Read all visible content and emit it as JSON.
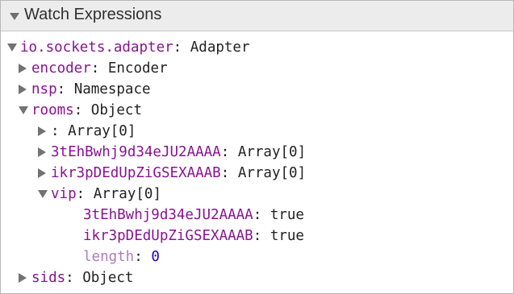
{
  "panel": {
    "title": "Watch Expressions"
  },
  "tree": {
    "root": {
      "key": "io.sockets.adapter",
      "sep": ":",
      "value": "Adapter"
    },
    "encoder": {
      "key": "encoder",
      "sep": ":",
      "value": "Encoder"
    },
    "nsp": {
      "key": "nsp",
      "sep": ":",
      "value": "Namespace"
    },
    "rooms": {
      "key": "rooms",
      "sep": ":",
      "value": "Object"
    },
    "room_empty": {
      "key": "",
      "sep": ":",
      "value": "Array[0]"
    },
    "room_1": {
      "key": "3tEhBwhj9d34eJU2AAAA",
      "sep": ":",
      "value": "Array[0]"
    },
    "room_2": {
      "key": "ikr3pDEdUpZiGSEXAAAB",
      "sep": ":",
      "value": "Array[0]"
    },
    "vip": {
      "key": "vip",
      "sep": ":",
      "value": "Array[0]"
    },
    "vip_1": {
      "key": "3tEhBwhj9d34eJU2AAAA",
      "sep": ":",
      "value": "true"
    },
    "vip_2": {
      "key": "ikr3pDEdUpZiGSEXAAAB",
      "sep": ":",
      "value": "true"
    },
    "vip_length": {
      "key": "length",
      "sep": ":",
      "value": "0"
    },
    "sids": {
      "key": "sids",
      "sep": ":",
      "value": "Object"
    }
  },
  "colors": {
    "property_key": "#881391",
    "internal_key": "#b07bbd",
    "number_value": "#1c00cf",
    "header_background": "#ececec"
  }
}
